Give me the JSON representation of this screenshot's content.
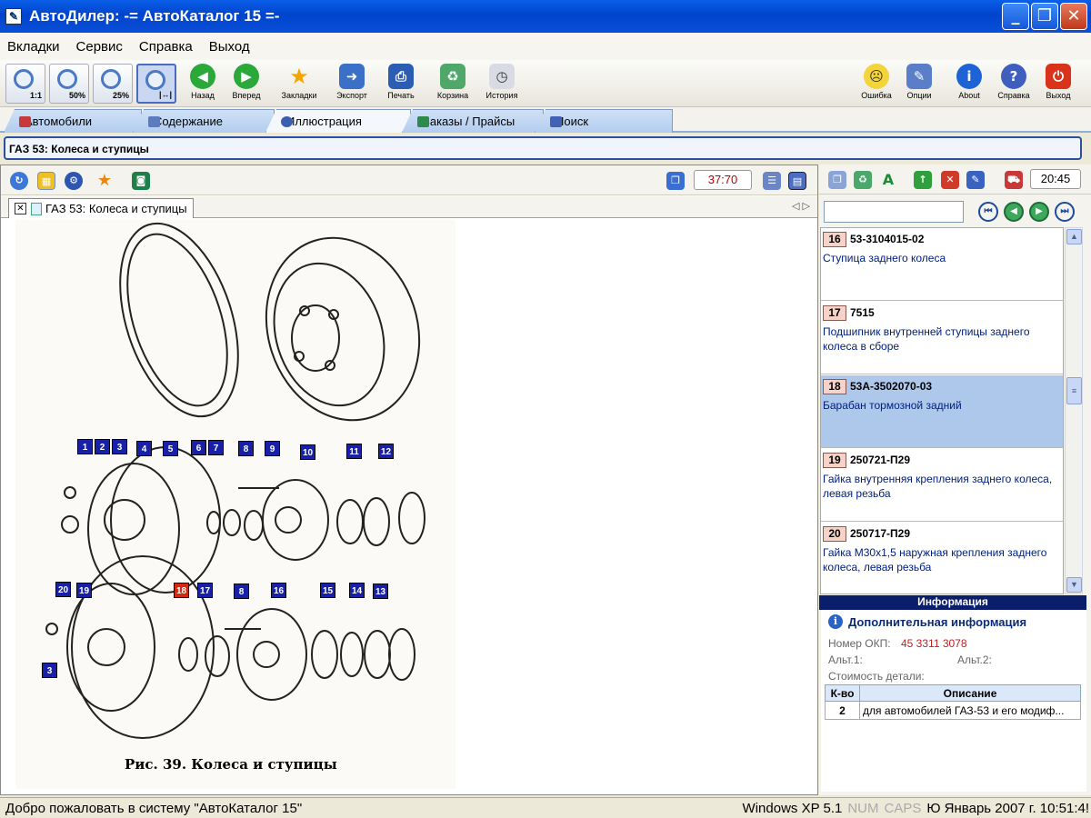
{
  "window": {
    "title": "АвтоДилер: -= АвтоКаталог 15 =-"
  },
  "menu": [
    "Вкладки",
    "Сервис",
    "Справка",
    "Выход"
  ],
  "toolbar": {
    "zoom": [
      "1:1",
      "50%",
      "25%",
      ""
    ],
    "buttons": [
      "Назад",
      "Вперед",
      "Закладки",
      "Экспорт",
      "Печать",
      "Корзина",
      "История"
    ],
    "right": [
      "Ошибка",
      "Опции",
      "About",
      "Справка",
      "Выход"
    ]
  },
  "tabs": [
    "Автомобили",
    "Содержание",
    "Иллюстрация",
    "Заказы / Прайсы",
    "Поиск"
  ],
  "breadcrumb": "ГАЗ 53: Колеса и ступицы",
  "illustration": {
    "counter": "37:70",
    "doc_tab": "ГАЗ 53: Колеса и ступицы",
    "caption": "Рис. 39. Колеса и ступицы",
    "callouts_top": [
      "1",
      "2",
      "3",
      "4",
      "5",
      "6",
      "7",
      "8",
      "9",
      "10",
      "11",
      "12"
    ],
    "callouts_bottom": [
      "20",
      "19",
      "18",
      "17",
      "8",
      "16",
      "15",
      "14",
      "13",
      "3"
    ]
  },
  "right_panel": {
    "time": "20:45",
    "search_value": "",
    "parts": [
      {
        "num": "16",
        "code": "53-3104015-02",
        "desc": "Ступица заднего колеса",
        "selected": false
      },
      {
        "num": "17",
        "code": "7515",
        "desc": "Подшипник внутренней ступицы заднего колеса в сборе",
        "selected": false
      },
      {
        "num": "18",
        "code": "53А-3502070-03",
        "desc": "Барабан тормозной задний",
        "selected": true
      },
      {
        "num": "19",
        "code": "250721-П29",
        "desc": "Гайка внутренняя крепления заднего колеса, левая резьба",
        "selected": false
      },
      {
        "num": "20",
        "code": "250717-П29",
        "desc": "Гайка М30х1,5 наружная крепления заднего колеса, левая резьба",
        "selected": false
      }
    ]
  },
  "info": {
    "header": "Информация",
    "subheader": "Дополнительная информация",
    "okp_label": "Номер ОКП:",
    "okp_value": "45 3311 3078",
    "alt1_label": "Альт.1:",
    "alt2_label": "Альт.2:",
    "cost_label": "Стоимость детали:",
    "table_headers": [
      "К-во",
      "Описание"
    ],
    "rows": [
      {
        "qty": "2",
        "desc": "для автомобилей ГАЗ-53 и его модиф..."
      }
    ]
  },
  "status": {
    "message": "Добро пожаловать в систему \"АвтоКаталог 15\"",
    "os": "Windows XP 5.1",
    "num": "NUM",
    "caps": "CAPS",
    "datetime": "Ю Январь 2007 г. 10:51:4!"
  }
}
